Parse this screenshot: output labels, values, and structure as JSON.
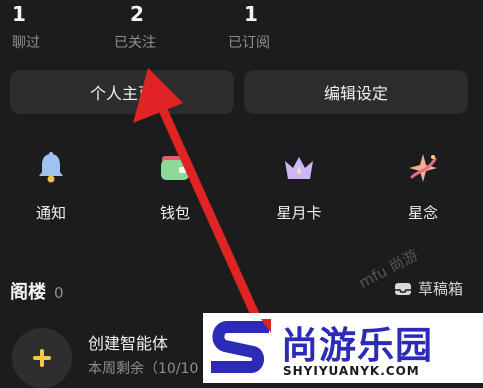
{
  "stats": [
    {
      "count": "1",
      "label": "聊过"
    },
    {
      "count": "2",
      "label": "已关注"
    },
    {
      "count": "1",
      "label": "已订阅"
    }
  ],
  "buttons": {
    "profile": "个人主页",
    "edit": "编辑设定"
  },
  "functions": [
    {
      "label": "通知",
      "icon": "bell-icon"
    },
    {
      "label": "钱包",
      "icon": "wallet-icon"
    },
    {
      "label": "星月卡",
      "icon": "crown-icon"
    },
    {
      "label": "星念",
      "icon": "sparkle-icon"
    }
  ],
  "section": {
    "title": "阁楼",
    "count": "0",
    "drafts": "草稿箱"
  },
  "agent": {
    "title": "创建智能体",
    "subtitle": "本周剩余（10/10"
  },
  "watermark": {
    "brand": "尚游乐园",
    "domain": "SHYIYUANYK.COM",
    "small_text": "mfu 尚游"
  },
  "colors": {
    "arrow": "#e02424",
    "brand_blue": "#2b2bb8"
  }
}
